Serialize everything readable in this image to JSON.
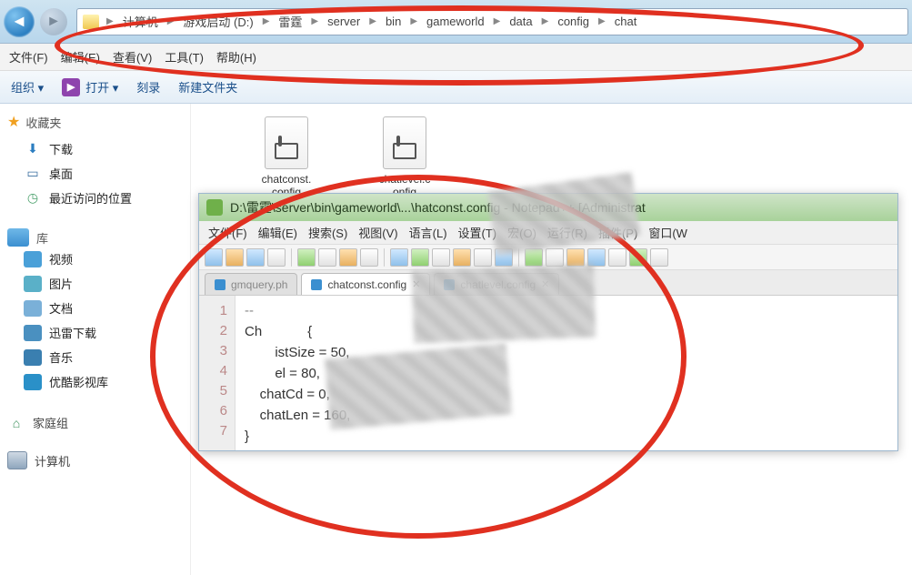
{
  "breadcrumb": [
    "计算机",
    "游戏启动 (D:)",
    "雷霆",
    "server",
    "bin",
    "gameworld",
    "data",
    "config",
    "chat"
  ],
  "menubar": {
    "file": "文件(F)",
    "edit": "编辑(E)",
    "view": "查看(V)",
    "tools": "工具(T)",
    "help": "帮助(H)"
  },
  "toolbar": {
    "org": "组织 ▾",
    "open": "打开 ▾",
    "burn": "刻录",
    "newfolder": "新建文件夹"
  },
  "sidebar": {
    "fav_header": "收藏夹",
    "downloads": "下载",
    "desktop": "桌面",
    "recent": "最近访问的位置",
    "lib_header": "库",
    "video": "视频",
    "pictures": "图片",
    "docs": "文档",
    "xunlei": "迅雷下载",
    "music": "音乐",
    "youku": "优酷影视库",
    "homegroup": "家庭组",
    "computer": "计算机"
  },
  "files": {
    "f1_line1": "chatconst.",
    "f1_line2": "config",
    "f2_line1": "chatlevel.c",
    "f2_line2": "onfig"
  },
  "npp": {
    "title": "D:\\雷霆\\server\\bin\\gameworld\\...\\hatconst.config - Notepad++ [Administrat",
    "menu": {
      "file": "文件(F)",
      "edit": "编辑(E)",
      "search": "搜索(S)",
      "view": "视图(V)",
      "lang": "语言(L)",
      "settings": "设置(T)",
      "macro": "宏(O)",
      "run": "运行(R)",
      "plugins": "插件(P)",
      "window": "窗口(W"
    },
    "tabs": {
      "t1": "gmquery.ph",
      "t2": "chatconst.config",
      "t3": "chatlevel.config"
    },
    "gutter": [
      "1",
      "2",
      "3",
      "4",
      "5",
      "6",
      "7"
    ],
    "code": {
      "l1": "--",
      "l2": "Ch            {",
      "l3": "        istSize = 50,",
      "l4": "        el = 80,",
      "l5": "    chatCd = 0,",
      "l6": "    chatLen = 160,",
      "l7": "}"
    }
  }
}
